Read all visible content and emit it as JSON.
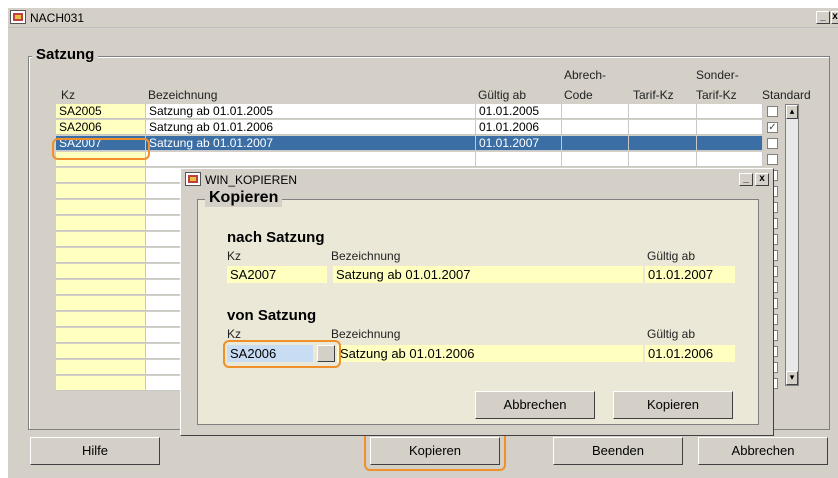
{
  "main_window": {
    "title": "NACH031",
    "min_label": "_",
    "close_label": "x"
  },
  "satzung": {
    "legend": "Satzung",
    "headers": {
      "kz": "Kz",
      "bezeichnung": "Bezeichnung",
      "gueltig_ab": "Gültig ab",
      "abrech_code_1": "Abrech-",
      "abrech_code_2": "Code",
      "tarif_kz": "Tarif-Kz",
      "sonder_1": "Sonder-",
      "sonder_2": "Tarif-Kz",
      "standard": "Standard"
    },
    "rows": [
      {
        "kz": "SA2005",
        "bezeichnung": "Satzung ab 01.01.2005",
        "gueltig_ab": "01.01.2005",
        "abrech_code": "",
        "tarif_kz": "",
        "sonder_tarif_kz": "",
        "standard": false
      },
      {
        "kz": "SA2006",
        "bezeichnung": "Satzung ab 01.01.2006",
        "gueltig_ab": "01.01.2006",
        "abrech_code": "",
        "tarif_kz": "",
        "sonder_tarif_kz": "",
        "standard": true
      },
      {
        "kz": "SA2007",
        "bezeichnung": "Satzung ab 01.01.2007",
        "gueltig_ab": "01.01.2007",
        "abrech_code": "",
        "tarif_kz": "",
        "sonder_tarif_kz": "",
        "standard": false,
        "selected": true
      }
    ]
  },
  "dialog": {
    "title": "WIN_KOPIEREN",
    "min_label": "_",
    "close_label": "x",
    "legend": "Kopieren",
    "nach": {
      "heading": "nach Satzung",
      "kz_label": "Kz",
      "bez_label": "Bezeichnung",
      "gueltig_label": "Gültig ab",
      "kz": "SA2007",
      "bezeichnung": "Satzung ab 01.01.2007",
      "gueltig_ab": "01.01.2007"
    },
    "von": {
      "heading": "von Satzung",
      "kz_label": "Kz",
      "bez_label": "Bezeichnung",
      "gueltig_label": "Gültig ab",
      "kz": "SA2006",
      "bezeichnung": "Satzung ab 01.01.2006",
      "gueltig_ab": "01.01.2006"
    },
    "buttons": {
      "abbrechen": "Abbrechen",
      "kopieren": "Kopieren"
    }
  },
  "bottom_buttons": {
    "hilfe": "Hilfe",
    "kopieren": "Kopieren",
    "beenden": "Beenden",
    "abbrechen": "Abbrechen"
  },
  "colors": {
    "accent_highlight": "#f0902a",
    "selection": "#3a6ea5",
    "kz_field": "#ffffc0"
  }
}
